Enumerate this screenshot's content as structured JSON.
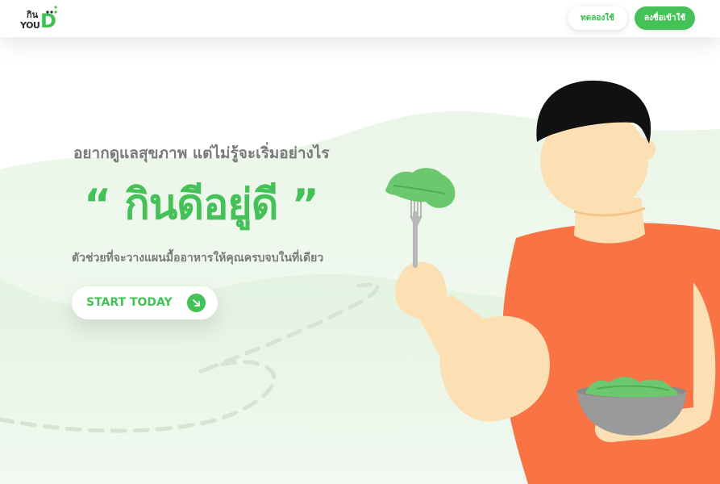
{
  "brand": {
    "logo_line1": "กิน",
    "logo_line2": "YOU",
    "logo_letter": "D"
  },
  "nav": {
    "try_label": "ทดลองใช้",
    "signup_label": "ลงชื่อเข้าใช้"
  },
  "hero": {
    "subtitle": "อยากดูแลสุขภาพ แต่ไม่รู้จะเริ่มอย่างไร",
    "headline": "“ กินดีอยู่ดี ”",
    "description": "ตัวช่วยที่จะวางแผนมื้ออาหารให้คุณครบจบในที่เดียว",
    "cta_label": "START TODAY"
  },
  "colors": {
    "brand_green": "#45c257",
    "text_gray": "#7a7a7a",
    "shirt_orange": "#f97345",
    "skin": "#fce0b4",
    "hair": "#111111",
    "bowl": "#9a9a9a"
  },
  "icons": {
    "cta_icon": "arrow-down-right-icon",
    "logo_dots": "dots-icon"
  }
}
